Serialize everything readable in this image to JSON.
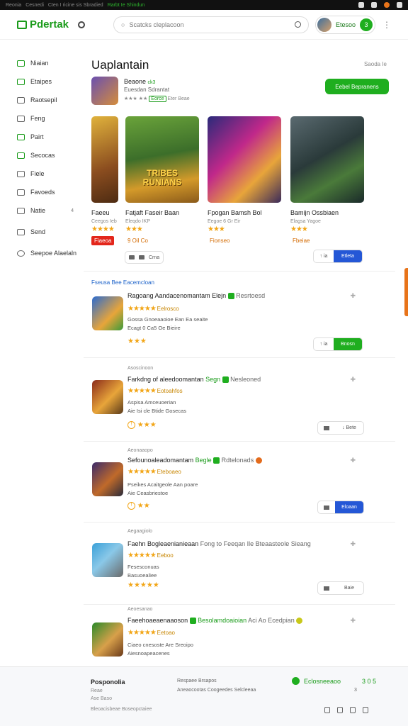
{
  "sysbar": {
    "items": [
      "Reonia",
      "Cesnedi",
      "Cten I ricine sis Sbradied"
    ],
    "highlight": "Rarbt Ie Shindun"
  },
  "header": {
    "logo": "Pdertak",
    "search_placeholder": "Scatcks cleplacoon",
    "user_name": "Etesoo",
    "user_badge": "3"
  },
  "sidebar": {
    "items": [
      {
        "label": "Niaian",
        "icon": "home-icon"
      },
      {
        "label": "Etaipes",
        "icon": "store-icon"
      },
      {
        "label": "Raotsepil",
        "icon": "list-icon"
      },
      {
        "label": "Feng",
        "icon": "doc-icon"
      },
      {
        "label": "Pairt",
        "icon": "flag-icon"
      },
      {
        "label": "Secocas",
        "icon": "grid-icon"
      },
      {
        "label": "Fiele",
        "icon": "gear-icon"
      },
      {
        "label": "Favoeds",
        "icon": "heart-icon"
      },
      {
        "label": "Natie",
        "icon": "mail-icon",
        "extra": "4"
      },
      {
        "label": "Send",
        "icon": "send-icon"
      },
      {
        "label": "Seepoe Alaelaln",
        "icon": "clock-icon"
      }
    ]
  },
  "main": {
    "title": "Uaplantain",
    "see_all": "Saoda Ie",
    "featured": {
      "title": "Beaone",
      "version": "ck3",
      "subtitle": "Euesdan Sdrantat",
      "rating_line": "★★★ ★★",
      "tag": "Eorce",
      "tag_after": "Eter Beae",
      "button": "Eebel Bepranens"
    },
    "cards": [
      {
        "title": "Faeeu",
        "sub": "Ceegos Ieb",
        "stars": "★★★★",
        "price": "Fiaeoa",
        "price_style": "red"
      },
      {
        "title": "Fatjaft Faseir Baan",
        "sub": "Eleqdo IKP",
        "stars": "★★★",
        "price": "9 Oil Co",
        "price_style": "plain",
        "cover_title": "TRIBES RUNIANS"
      },
      {
        "title": "Fpogan Bamsh Bol",
        "sub": "Eegoe 6 Gr Eir",
        "stars": "★★★",
        "price": "Fionseo",
        "price_style": "plain"
      },
      {
        "title": "Bamijn Ossbiaen",
        "sub": "Elagsa Yagoe",
        "stars": "★★★",
        "price": "Fbeiae",
        "price_style": "plain"
      }
    ],
    "pill_text": "Crna",
    "card_button_left": "↑ ia",
    "card_button_right": "Etleta"
  },
  "list": {
    "section_title": "Fseusa Bee Eacemcloan",
    "items": [
      {
        "title": "Ragoang Aandacenomantam Elejn",
        "tag": "Resrtoesd",
        "rating": "Eelrosco",
        "desc": [
          "Gossa Gnoeaaoioe Ean Ea seaite",
          "Ecagt 0 Ca5 Oe Bieire"
        ],
        "small": "★★★",
        "date": "",
        "btn_left": "↑ ia",
        "btn_right": "Bnosn",
        "btn_style": "g"
      },
      {
        "title": "Farkdng of aleedoomantan",
        "tag_green": "Segn",
        "tag": "Nesleoned",
        "rating": "Eotoahfos",
        "desc": [
          "Aspisa Amceuoerian",
          "Aie Isi cle Btide Gosecas"
        ],
        "small": "★★★",
        "date": "Asoscinoon",
        "btn_left": "",
        "btn_right": "↓ Bete",
        "btn_style": "w"
      },
      {
        "title": "Sefounoaleadomantam",
        "tag_green": "Begle",
        "tag": "Rdtelonads",
        "rating": "Eteboaeo",
        "desc": [
          "Pseikes Acaitgeole Aan poare",
          "Aie Ceasbriestoe"
        ],
        "small": "★★",
        "date": "Aeonaaopo",
        "btn_left": "",
        "btn_right": "Eloaan",
        "btn_style": "b"
      },
      {
        "title": "Faehn Bogleaenianieaan",
        "tag_tail": "Fong to Feeqan Ile Bteaasteole Sieang",
        "rating": "Eeboo",
        "desc": [
          "Fesesconuas",
          "Basuoealiee"
        ],
        "small": "★★★★★",
        "date": "Aegaagiolo",
        "btn_left": "",
        "btn_right": "Baie",
        "btn_style": "w"
      },
      {
        "title": "Faeehoaeaenaaoson",
        "tag_green": "Besolamdoaioian",
        "tag": "Aci Ao Ecedpian",
        "rating": "Eetoao",
        "desc": [
          "Ciaeo cnesoste Are Sreoipo",
          "Aiesnoapeacenes"
        ],
        "small": "",
        "date": "Aeoesanao",
        "btn_left": "",
        "btn_right": "",
        "btn_style": "none"
      }
    ]
  },
  "footer": {
    "title": "Posponolia",
    "line1": "Reae",
    "line2": "Ase Baso",
    "line3": "Bleoacisbeae Boseopctaiee",
    "col2a": "Respaee Brsapos",
    "col2b": "Aneaocootas Coogeedes Selcleeaa",
    "brand": "Eclosneeaoo",
    "brand_right": "3 0 5",
    "meta": "3"
  }
}
